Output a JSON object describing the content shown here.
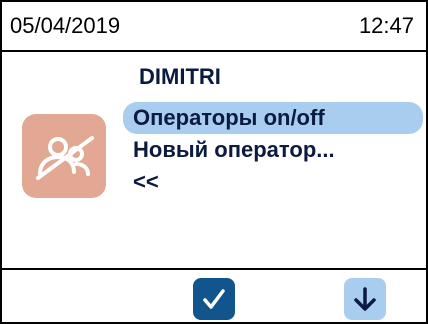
{
  "status_bar": {
    "date": "05/04/2019",
    "time": "12:47"
  },
  "header": {
    "title": "DIMITRI"
  },
  "menu": {
    "items": [
      {
        "label": "Операторы on/off",
        "selected": true
      },
      {
        "label": "Новый оператор...",
        "selected": false
      },
      {
        "label": "<<",
        "selected": false
      }
    ]
  },
  "icons": {
    "tile": "operators-off-icon",
    "confirm": "check-icon",
    "down": "arrow-down-icon"
  },
  "colors": {
    "tile_bg": "#e3a893",
    "selected_bg": "#a9cdef",
    "confirm_bg": "#12558c",
    "down_bg": "#a9cdef",
    "text": "#0b1a3f"
  }
}
